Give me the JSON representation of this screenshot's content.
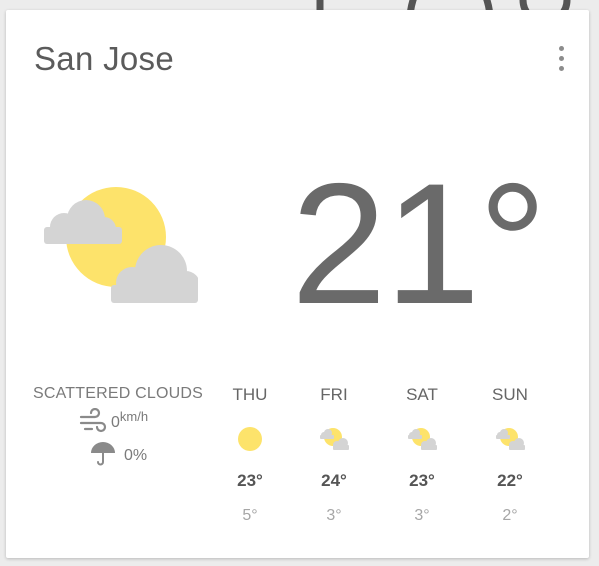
{
  "location": {
    "city": "San Jose"
  },
  "current": {
    "temperature": "21°",
    "condition": "SCATTERED CLOUDS",
    "icon": "partly-cloudy-icon",
    "wind_speed": "0",
    "wind_unit": "km/h",
    "precipitation": "0%"
  },
  "forecast": [
    {
      "day": "THU",
      "icon": "sunny-icon",
      "high": "23°",
      "low": "5°"
    },
    {
      "day": "FRI",
      "icon": "partly-cloudy-icon",
      "high": "24°",
      "low": "3°"
    },
    {
      "day": "SAT",
      "icon": "partly-cloudy-icon",
      "high": "23°",
      "low": "3°"
    },
    {
      "day": "SUN",
      "icon": "partly-cloudy-icon",
      "high": "22°",
      "low": "2°"
    }
  ],
  "colors": {
    "sun": "#FDE36B",
    "cloud": "#D3D3D3",
    "text_dark": "#6a6a6a",
    "text_muted": "#a6a6a6"
  }
}
